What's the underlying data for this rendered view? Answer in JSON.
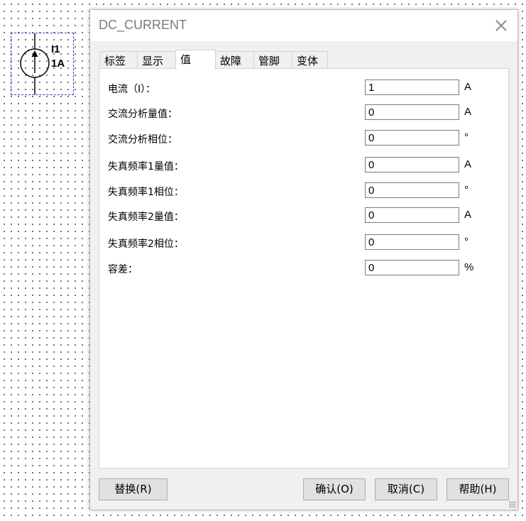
{
  "component": {
    "ref": "I1",
    "value": "1A",
    "symbol_icon": "dc-current-source-icon"
  },
  "dialog": {
    "title": "DC_CURRENT",
    "close_icon": "close-icon"
  },
  "tabs": [
    {
      "label": "标签",
      "active": false
    },
    {
      "label": "显示",
      "active": false
    },
    {
      "label": "值",
      "active": true
    },
    {
      "label": "故障",
      "active": false
    },
    {
      "label": "管脚",
      "active": false
    },
    {
      "label": "变体",
      "active": false
    }
  ],
  "fields": [
    {
      "label": "电流（I）：",
      "value": "1",
      "unit": "A"
    },
    {
      "label": "交流分析量值：",
      "value": "0",
      "unit": "A"
    },
    {
      "label": "交流分析相位：",
      "value": "0",
      "unit": "°"
    },
    {
      "label": "失真频率1量值：",
      "value": "0",
      "unit": "A"
    },
    {
      "label": "失真频率1相位：",
      "value": "0",
      "unit": "°"
    },
    {
      "label": "失真频率2量值：",
      "value": "0",
      "unit": "A"
    },
    {
      "label": "失真频率2相位：",
      "value": "0",
      "unit": "°"
    },
    {
      "label": "容差：",
      "value": "0",
      "unit": "%"
    }
  ],
  "buttons": {
    "replace": "替换(R)",
    "ok": "确认(O)",
    "cancel": "取消(C)",
    "help": "帮助(H)"
  },
  "colors": {
    "selection_border": "#2b3fbf",
    "dialog_bg": "#f0f0f0",
    "panel_bg": "#ffffff",
    "button_bg": "#e1e1e1"
  }
}
